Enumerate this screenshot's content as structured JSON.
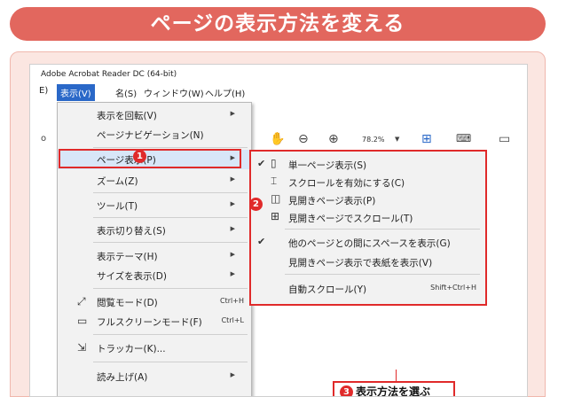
{
  "banner": {
    "title": "ページの表示方法を変える"
  },
  "app": {
    "title": "Adobe Acrobat Reader DC (64-bit)"
  },
  "menubar": {
    "edit": "E)",
    "view": "表示(V)",
    "doc": "名(S)",
    "window": "ウィンドウ(W)",
    "help": "ヘルプ(H)"
  },
  "toolbar": {
    "zoom": "78.2%",
    "left_mark": "o"
  },
  "view_menu": {
    "rotate": "表示を回転(V)",
    "page_nav": "ページナビゲーション(N)",
    "page_display": "ページ表示(P)",
    "zoom": "ズーム(Z)",
    "tools": "ツール(T)",
    "switch": "表示切り替え(S)",
    "theme": "表示テーマ(H)",
    "size": "サイズを表示(D)",
    "reading_mode": "閲覧モード(D)",
    "reading_mode_sc": "Ctrl+H",
    "fullscreen": "フルスクリーンモード(F)",
    "fullscreen_sc": "Ctrl+L",
    "tracker": "トラッカー(K)...",
    "read_aloud": "読み上げ(A)"
  },
  "page_display_menu": {
    "single": "単一ページ表示(S)",
    "scroll": "スクロールを有効にする(C)",
    "two_page": "見開きページ表示(P)",
    "two_page_scroll": "見開きページでスクロール(T)",
    "gaps": "他のページとの間にスペースを表示(G)",
    "cover": "見開きページ表示で表紙を表示(V)",
    "auto_scroll": "自動スクロール(Y)",
    "auto_scroll_sc": "Shift+Ctrl+H"
  },
  "annotations": {
    "badge1": "1",
    "badge2": "2",
    "badge3": "3",
    "callout": "表示方法を選ぶ"
  },
  "colors": {
    "accent": "#e2675e",
    "highlight": "#e02a2a",
    "selection": "#2a68c8"
  }
}
